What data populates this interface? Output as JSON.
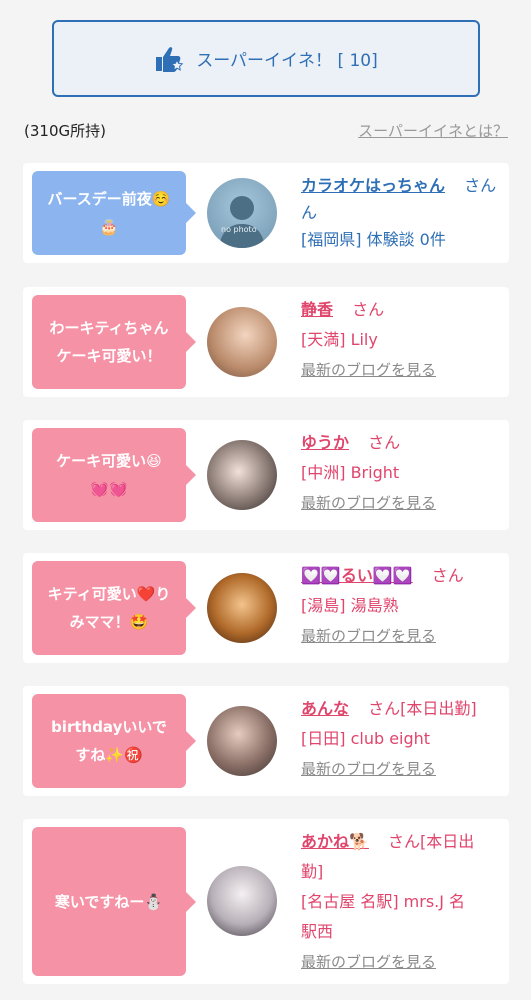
{
  "super_button": {
    "label": "スーパーイイネ！ [ 10]"
  },
  "info": {
    "points": "(310G所持)",
    "what_link": "スーパーイイネとは？"
  },
  "cards": [
    {
      "message_line1": "バースデー前夜☺️",
      "message_line2": "🎂",
      "name": "カラオケはっちゃん",
      "san": "さん",
      "san2": "ん",
      "detail": "[福岡県] 体験談 0件",
      "blog": ""
    },
    {
      "message_line1": "わーキティちゃん",
      "message_line2": "ケーキ可愛い！",
      "name": "静香",
      "san": "さん",
      "detail": "[天満] Lily",
      "blog": "最新のブログを見る"
    },
    {
      "message_line1": "ケーキ可愛い😆",
      "message_line2": "💓💓",
      "name": "ゆうか",
      "san": "さん",
      "detail": "[中洲] Bright",
      "blog": "最新のブログを見る"
    },
    {
      "message_line1": "キティ可愛い❤️り",
      "message_line2": "みママ！🤩",
      "name": "💟💟るい💟💟",
      "san": "さん",
      "detail": "[湯島] 湯島熟",
      "blog": "最新のブログを見る"
    },
    {
      "message_line1": "birthdayいいで",
      "message_line2": "すね✨㊗️",
      "name": "あんな",
      "san": "さん[本日出勤]",
      "detail": "[日田] club eight",
      "blog": "最新のブログを見る"
    },
    {
      "message_line1": "寒いですねー⛄",
      "message_line2": "",
      "name": "あかね🐕",
      "san": "さん[本日出",
      "san2": "勤]",
      "detail": "[名古屋 名駅] mrs.J 名",
      "detail2": "駅西",
      "blog": "最新のブログを見る"
    }
  ],
  "colors": {
    "accent_blue": "#2e6fb5",
    "accent_pink": "#e0456c",
    "bubble_blue": "#8cb4ee",
    "bubble_pink": "#f592a6"
  }
}
